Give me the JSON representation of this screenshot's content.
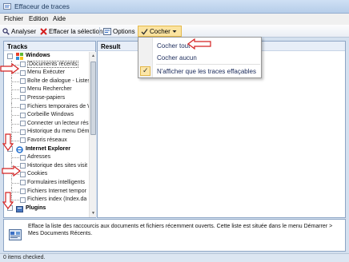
{
  "window": {
    "title": "Effaceur de traces"
  },
  "menubar": {
    "items": [
      "Fichier",
      "Edition",
      "Aide"
    ]
  },
  "toolbar": {
    "analyser": "Analyser",
    "effacer": "Effacer la sélection",
    "options": "Options",
    "cocher": "Cocher"
  },
  "tracks": {
    "header": "Tracks",
    "rows": [
      {
        "type": "cat",
        "label": "Windows",
        "icon": "windows-flag-icon"
      },
      {
        "type": "item",
        "label": "Documents récents"
      },
      {
        "type": "item",
        "label": "Menu Exécuter"
      },
      {
        "type": "item",
        "label": "Boîte de dialogue - Listes"
      },
      {
        "type": "item",
        "label": "Menu Rechercher"
      },
      {
        "type": "item",
        "label": "Presse-papiers"
      },
      {
        "type": "item",
        "label": "Fichiers temporaires de W"
      },
      {
        "type": "item",
        "label": "Corbeille Windows"
      },
      {
        "type": "item",
        "label": "Connecter un lecteur rés"
      },
      {
        "type": "item",
        "label": "Historique du menu Dém"
      },
      {
        "type": "item",
        "label": "Favoris réseaux"
      },
      {
        "type": "cat",
        "label": "Internet Explorer",
        "icon": "internet-explorer-icon"
      },
      {
        "type": "item",
        "label": "Adresses"
      },
      {
        "type": "item",
        "label": "Historique des sites visit"
      },
      {
        "type": "item",
        "label": "Cookies"
      },
      {
        "type": "item",
        "label": "Formulaires intelligents"
      },
      {
        "type": "item",
        "label": "Fichiers Internet tempor"
      },
      {
        "type": "item",
        "label": "Fichiers index (Index.da"
      },
      {
        "type": "cat",
        "label": "Plugins",
        "icon": "plugins-icon"
      }
    ]
  },
  "result": {
    "header": "Result"
  },
  "dropdown": {
    "items": [
      {
        "label": "Cocher tout",
        "checked": false
      },
      {
        "label": "Cocher aucun",
        "checked": false
      },
      {
        "label": "N'afficher que les traces effaçables",
        "checked": true
      }
    ]
  },
  "description": {
    "text": "Efface la liste des raccourcis aux documents et fichiers récemment ouverts. Cette liste est située dans le menu Démarrer > Mes Documents Récents."
  },
  "status": {
    "text": "0 items checked."
  },
  "colors": {
    "accent_red": "#d42020",
    "highlight": "#fbe3a0"
  }
}
